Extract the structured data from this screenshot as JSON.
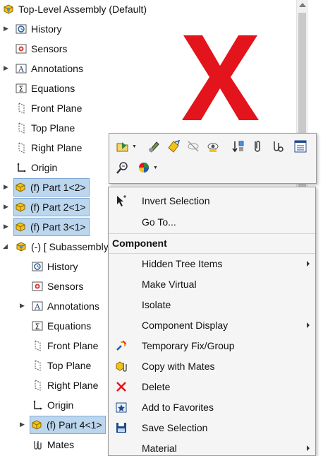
{
  "tree": {
    "root": "Top-Level Assembly  (Default)",
    "history": "History",
    "sensors": "Sensors",
    "annotations": "Annotations",
    "equations": "Equations",
    "front_plane": "Front Plane",
    "top_plane": "Top Plane",
    "right_plane": "Right Plane",
    "origin": "Origin",
    "part1": "(f) Part 1<2>",
    "part2": "(f) Part 2<1>",
    "part3": "(f) Part 3<1>",
    "subassembly": "(-) [ Subassembly",
    "sub_history": "History",
    "sub_sensors": "Sensors",
    "sub_annotations": "Annotations",
    "sub_equations": "Equations",
    "sub_front_plane": "Front Plane",
    "sub_top_plane": "Top Plane",
    "sub_right_plane": "Right Plane",
    "sub_origin": "Origin",
    "part4": "(f) Part 4<1>",
    "mates": "Mates"
  },
  "context_menu": {
    "invert_selection": "Invert Selection",
    "go_to": "Go To...",
    "component_header": "Component",
    "hidden_tree_items": "Hidden Tree Items",
    "make_virtual": "Make Virtual",
    "isolate": "Isolate",
    "component_display": "Component Display",
    "temporary_fix": "Temporary Fix/Group",
    "copy_with_mates": "Copy with Mates",
    "delete": "Delete",
    "add_to_favorites": "Add to Favorites",
    "save_selection": "Save Selection",
    "material": "Material"
  },
  "colors": {
    "selection": "#bcd6ee",
    "big_x": "#e3141b",
    "part_icon": "#f2c21b"
  }
}
